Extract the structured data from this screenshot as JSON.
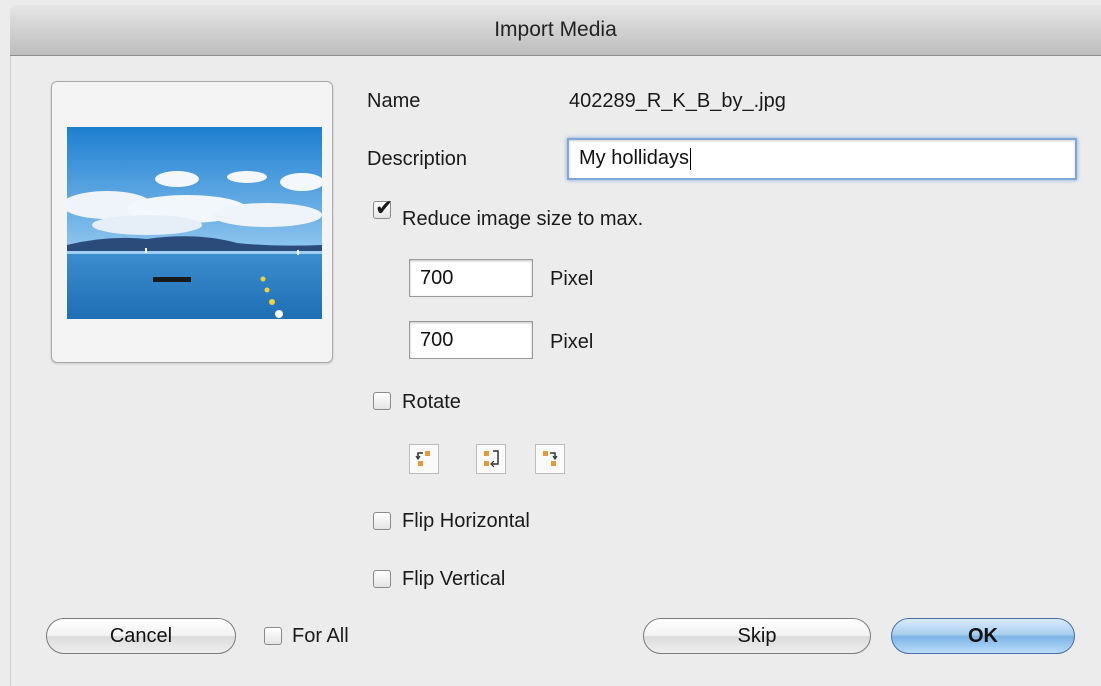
{
  "window": {
    "title": "Import Media"
  },
  "fields": {
    "name_label": "Name",
    "name_value": "402289_R_K_B_by_.jpg",
    "description_label": "Description",
    "description_value": "My hollidays"
  },
  "reduce": {
    "label": "Reduce image size to max.",
    "checked": true,
    "width_value": "700",
    "height_value": "700",
    "unit": "Pixel"
  },
  "rotate": {
    "label": "Rotate",
    "checked": false,
    "buttons": [
      "rotate-left-icon",
      "rotate-180-icon",
      "rotate-right-icon"
    ]
  },
  "flip": {
    "horizontal_label": "Flip Horizontal",
    "horizontal_checked": false,
    "vertical_label": "Flip Vertical",
    "vertical_checked": false
  },
  "footer": {
    "cancel_label": "Cancel",
    "for_all_label": "For All",
    "for_all_checked": false,
    "skip_label": "Skip",
    "ok_label": "OK"
  },
  "colors": {
    "default_button": "#7db4e6",
    "focus_ring": "#7fa7d8",
    "accent_icon": "#e69a3c"
  }
}
